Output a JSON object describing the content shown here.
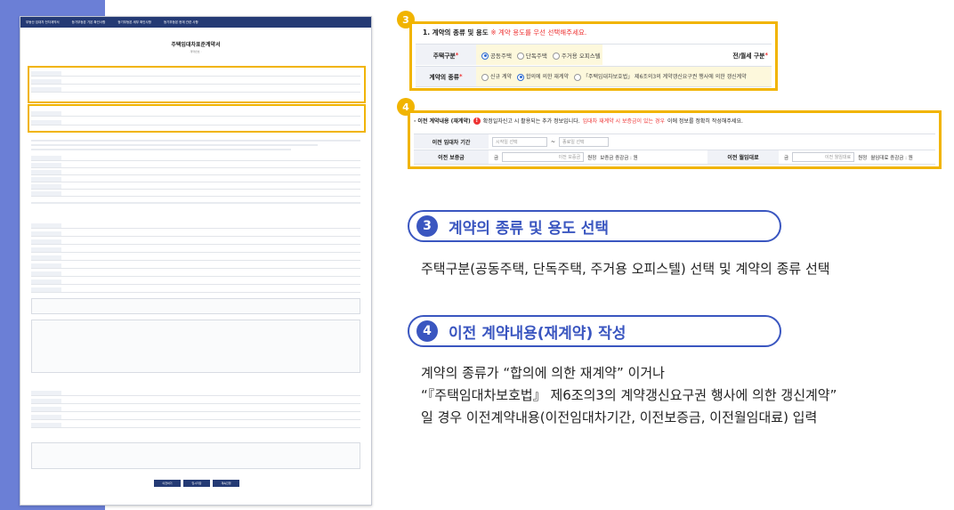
{
  "doc_preview": {
    "nav": [
      "부동산 임대차 전자계약서",
      "등기부등본 기본 확인사항",
      "등기부등본 세부 확인사항",
      "등기부등본 현재 관련 사항"
    ],
    "title": "주택임대차표준계약서",
    "subtitle": "계약번호 :",
    "buttons": [
      "이전하기",
      "임시저장",
      "계속진행"
    ]
  },
  "step3": {
    "badge": "3",
    "title": "1. 계약의 종류 및 용도",
    "notice": "※ 계약 용도를 우선 선택해주세요.",
    "house_type_label": "주택구분",
    "house_type_options": [
      "공동주택",
      "단독주택",
      "주거용 오피스텔"
    ],
    "house_type_selected": "공동주택",
    "rent_type_label": "전/월세 구분",
    "contract_type_label": "계약의 종류",
    "contract_type_options": [
      "신규 계약",
      "합의에 의한 재계약",
      "「주택임대차보호법」 제6조의3의 계약갱신요구권 행사에 의한 갱신계약"
    ],
    "contract_type_selected": "합의에 의한 재계약"
  },
  "step4": {
    "badge": "4",
    "title": "· 이전 계약내용 (재계약)",
    "info_icon": "!",
    "notice_a": "확정일자신고 시 활용되는 추가 정보입니다.",
    "notice_b": "임대차 재계약 시 보증금이 있는 경우",
    "notice_c": "이에 정보를 정확히 작성해주세요.",
    "period_label": "이전 임대차 기간",
    "period_start_placeholder": "시작일 선택",
    "period_sep": "~",
    "period_end_placeholder": "종료일 선택",
    "deposit_label": "이전 보증금",
    "deposit_prefix": "금",
    "deposit_placeholder": "이전 보증금",
    "deposit_unit": "원정",
    "deposit_change": "보증금 증감금 : 원",
    "monthly_label": "이전 월임대료",
    "monthly_prefix": "금",
    "monthly_placeholder": "이전 월임대료",
    "monthly_unit": "원정",
    "monthly_change": "월임대료 증감금 : 원"
  },
  "section3": {
    "num": "3",
    "heading": "계약의 종류 및 용도 선택",
    "desc": "주택구분(공동주택, 단독주택, 주거용 오피스텔) 선택 및 계약의 종류 선택"
  },
  "section4": {
    "num": "4",
    "heading": "이전 계약내용(재계약) 작성",
    "desc_line1": "계약의 종류가 “합의에 의한 재계약” 이거나",
    "desc_line2": "“『주택임대차보호법』 제6조의3의 계약갱신요구권 행사에 의한 갱신계약”",
    "desc_line3": "일 경우 이전계약내용(이전임대차기간, 이전보증금, 이전월임대료) 입력"
  },
  "colors": {
    "accent": "#f1b400",
    "brand": "#3a56c0",
    "nav": "#243a74",
    "sidebar": "#6b7fd6"
  }
}
